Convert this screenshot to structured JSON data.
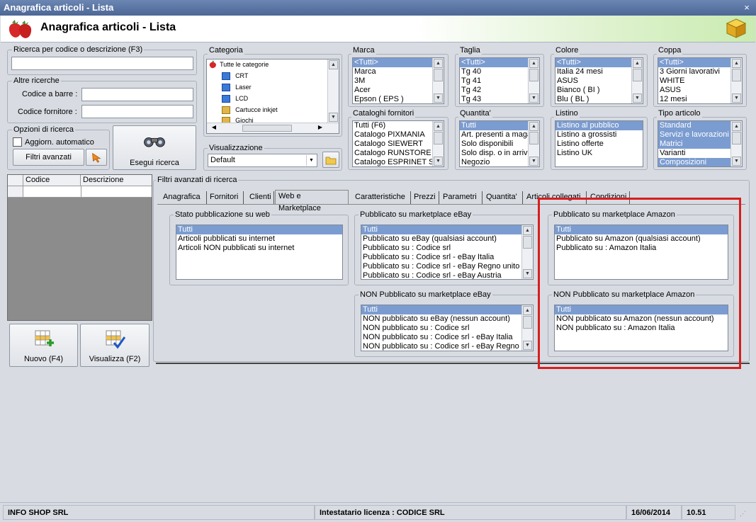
{
  "window": {
    "title": "Anagrafica articoli  - Lista",
    "close": "×"
  },
  "header": {
    "title": "Anagrafica articoli  - Lista"
  },
  "search": {
    "group": "Ricerca per codice o descrizione (F3)",
    "other_group": "Altre ricerche",
    "barcode_label": "Codice a barre :",
    "supplier_code_label": "Codice fornitore :",
    "options_group": "Opzioni di ricerca",
    "auto_update": "Aggiorn. automatico",
    "advanced_filters": "Filtri avanzati",
    "run_search": "Esegui ricerca"
  },
  "categoria": {
    "label": "Categoria",
    "items": [
      "Tutte le categorie",
      "CRT",
      "Laser",
      "LCD",
      "Cartucce inkjet",
      "Giochi"
    ]
  },
  "visualizzazione": {
    "label": "Visualizzazione",
    "value": "Default"
  },
  "lists": {
    "marca": {
      "label": "Marca",
      "items": [
        "<Tutti>",
        "Marca",
        "3M",
        "Acer",
        "Epson ( EPS )"
      ]
    },
    "taglia": {
      "label": "Taglia",
      "items": [
        "<Tutti>",
        "Tg 40",
        "Tg 41",
        "Tg 42",
        "Tg 43"
      ]
    },
    "colore": {
      "label": "Colore",
      "items": [
        "<Tutti>",
        "Italia 24 mesi",
        "ASUS",
        "Bianco ( BI )",
        "Blu ( BL )"
      ]
    },
    "coppa": {
      "label": "Coppa",
      "items": [
        "<Tutti>",
        "3 Giorni lavorativi",
        "WHITE",
        "ASUS",
        "12 mesi"
      ]
    },
    "cataloghi": {
      "label": "Cataloghi fornitori",
      "items": [
        "Tutti (F6)",
        "Catalogo PIXMANIA",
        "Catalogo SIEWERT",
        "Catalogo RUNSTORE",
        "Catalogo ESPRINET SPA"
      ]
    },
    "quantita": {
      "label": "Quantita'",
      "items": [
        "Tutti",
        "Art. presenti a magazzino",
        "Solo disponibili",
        "Solo disp. o in arrivo",
        "Negozio"
      ]
    },
    "listino": {
      "label": "Listino",
      "items": [
        "Listino al pubblico",
        "Listino a grossisti",
        "Listino offerte",
        "Listino UK"
      ]
    },
    "tipo": {
      "label": "Tipo articolo",
      "items": [
        "Standard",
        "Servizi e lavorazioni",
        "Matrici",
        "Varianti",
        "Composizioni"
      ]
    }
  },
  "grid": {
    "columns": [
      "Codice",
      "Descrizione"
    ]
  },
  "buttons": {
    "new": "Nuovo (F4)",
    "view": "Visualizza (F2)"
  },
  "filters": {
    "title": "Filtri avanzati di ricerca",
    "tabs": [
      "Anagrafica",
      "Fornitori",
      "Clienti",
      "Web e Marketplace",
      "Caratteristiche",
      "Prezzi",
      "Parametri",
      "Quantita'",
      "Articoli collegati",
      "Condizioni"
    ],
    "web": {
      "label": "Stato pubblicazione su web",
      "items": [
        "Tutti",
        "Articoli pubblicati su internet",
        "Articoli NON pubblicati su internet"
      ]
    },
    "ebay": {
      "label": "Pubblicato su marketplace eBay",
      "items": [
        "Tutti",
        "Pubblicato su eBay (qualsiasi account)",
        "Pubblicato su : Codice srl",
        "Pubblicato su : Codice srl - eBay Italia",
        "Pubblicato su : Codice srl - eBay Regno unito (UK)",
        "Pubblicato su : Codice srl - eBay Austria"
      ]
    },
    "ebay_non": {
      "label": "NON Pubblicato su marketplace eBay",
      "items": [
        "Tutti",
        "NON pubblicato su eBay (nessun account)",
        "NON pubblicato su : Codice srl",
        "NON pubblicato su : Codice srl - eBay Italia",
        "NON pubblicato su : Codice srl - eBay Regno unito"
      ]
    },
    "amazon": {
      "label": "Pubblicato su marketplace Amazon",
      "items": [
        "Tutti",
        "Pubblicato su Amazon (qualsiasi account)",
        "Pubblicato su : Amazon Italia"
      ]
    },
    "amazon_non": {
      "label": "NON Pubblicato su marketplace Amazon",
      "items": [
        "Tutti",
        "NON pubblicato su Amazon (nessun account)",
        "NON pubblicato su : Amazon Italia"
      ]
    }
  },
  "status": {
    "company": "INFO SHOP SRL",
    "license": "Intestatario licenza : CODICE SRL",
    "date": "16/06/2014",
    "time": "10.51"
  }
}
